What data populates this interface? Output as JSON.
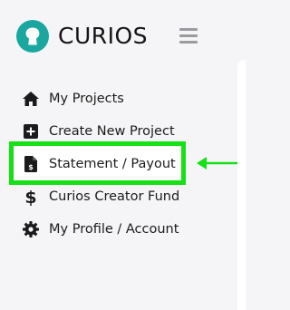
{
  "brand": {
    "name": "CURIOS",
    "accent_color": "#1aa7a0"
  },
  "header": {
    "menu_icon": "hamburger-icon"
  },
  "nav": {
    "items": [
      {
        "label": "My Projects",
        "icon": "home-icon"
      },
      {
        "label": "Create New Project",
        "icon": "plus-square-icon"
      },
      {
        "label": "Statement / Payout",
        "icon": "invoice-dollar-icon",
        "highlighted": true
      },
      {
        "label": "Curios Creator Fund",
        "icon": "dollar-icon"
      },
      {
        "label": "My Profile / Account",
        "icon": "gear-icon"
      }
    ]
  },
  "annotation": {
    "highlight_color": "#16e016",
    "arrow_icon": "left-arrow-icon"
  }
}
